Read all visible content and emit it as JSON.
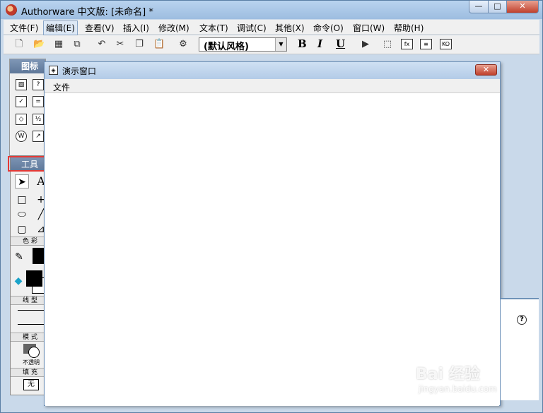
{
  "window": {
    "title": "Authorware 中文版: [未命名] *",
    "minimize": "—",
    "maximize": "□",
    "close": "✕"
  },
  "menu": {
    "items": [
      "文件(F)",
      "编辑(E)",
      "查看(V)",
      "插入(I)",
      "修改(M)",
      "文本(T)",
      "调试(C)",
      "其他(X)",
      "命令(O)",
      "窗口(W)",
      "帮助(H)"
    ]
  },
  "toolbar": {
    "style_value": "(默认风格)",
    "bold": "B",
    "italic": "I",
    "underline": "U"
  },
  "icon_palette": {
    "title": "图标"
  },
  "tools_panel": {
    "title": "工具",
    "color_label": "色彩",
    "line_label": "线型",
    "mode_label": "模式",
    "mode_value": "不透明",
    "fill_label": "填充",
    "fill_value": "无"
  },
  "presentation": {
    "title": "演示窗口",
    "menu_file": "文件"
  },
  "watermark": {
    "brand": "Bai 经验",
    "sub": "jingyan.baidu.com"
  },
  "colors": {
    "accent_red": "#e53935",
    "title_blue": "#6f93b8"
  }
}
